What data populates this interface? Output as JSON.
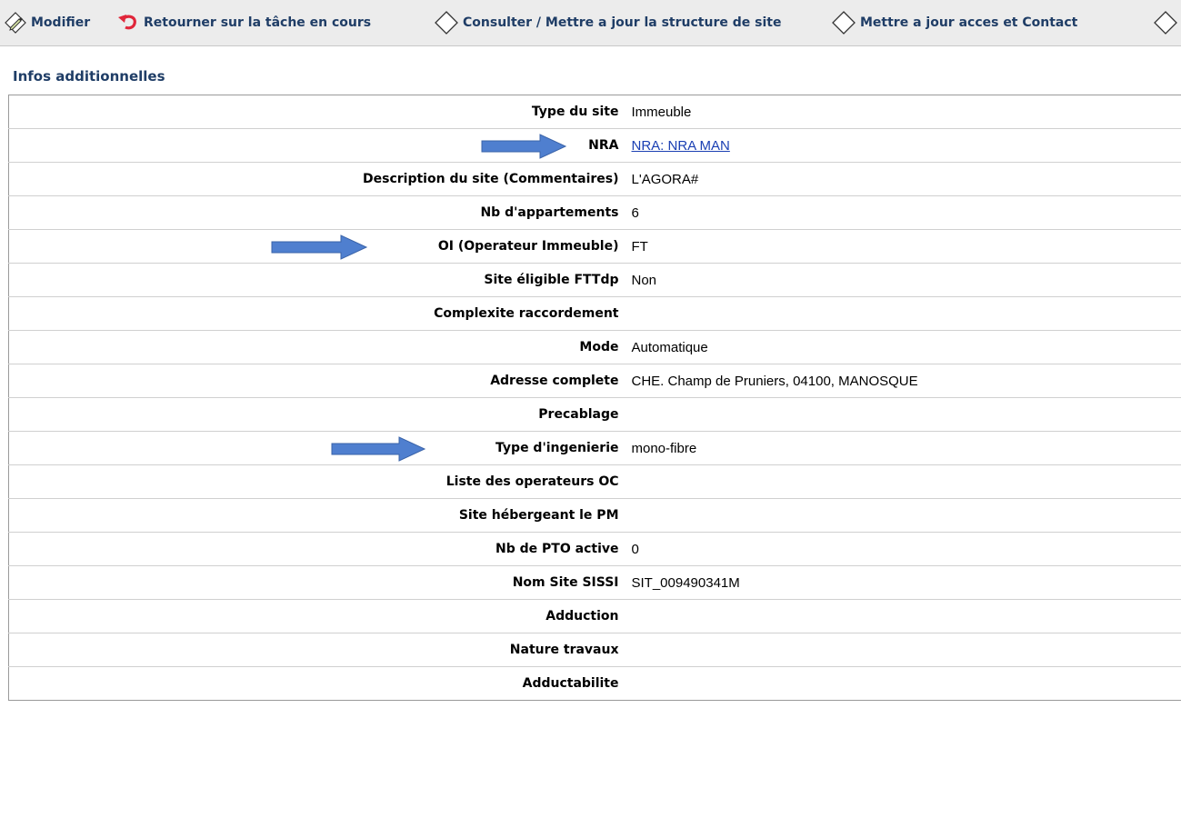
{
  "toolbar": {
    "items": [
      {
        "label": "Modifier",
        "icon": "edit-pencil-icon"
      },
      {
        "label": "Retourner sur la tâche en cours",
        "icon": "return-arrow-icon"
      },
      {
        "label": "Consulter / Mettre a jour la structure de site",
        "icon": "diamond-icon"
      },
      {
        "label": "Mettre a jour acces et Contact",
        "icon": "diamond-icon"
      }
    ]
  },
  "section": {
    "title": "Infos additionnelles"
  },
  "rows": [
    {
      "label": "Type du site",
      "value": "Immeuble"
    },
    {
      "label": "NRA",
      "value": "NRA: NRA MAN"
    },
    {
      "label": "Description du site (Commentaires)",
      "value": "L'AGORA#"
    },
    {
      "label": "Nb d'appartements",
      "value": "6"
    },
    {
      "label": "OI (Operateur Immeuble)",
      "value": "FT"
    },
    {
      "label": "Site éligible FTTdp",
      "value": "Non"
    },
    {
      "label": "Complexite raccordement",
      "value": ""
    },
    {
      "label": "Mode",
      "value": "Automatique"
    },
    {
      "label": "Adresse complete",
      "value": "CHE. Champ de Pruniers, 04100, MANOSQUE"
    },
    {
      "label": "Precablage",
      "value": ""
    },
    {
      "label": "Type d'ingenierie",
      "value": "mono-fibre"
    },
    {
      "label": "Liste des operateurs OC",
      "value": ""
    },
    {
      "label": "Site hébergeant le PM",
      "value": ""
    },
    {
      "label": "Nb de PTO active",
      "value": "0"
    },
    {
      "label": "Nom Site SISSI",
      "value": "SIT_009490341M"
    },
    {
      "label": "Adduction",
      "value": ""
    },
    {
      "label": "Nature travaux",
      "value": ""
    },
    {
      "label": "Adductabilite",
      "value": ""
    }
  ],
  "colors": {
    "link": "#1a3fb3",
    "heading": "#1f3d66",
    "annotation_arrow": "#4f7fcf",
    "return_icon": "#e0263a"
  }
}
